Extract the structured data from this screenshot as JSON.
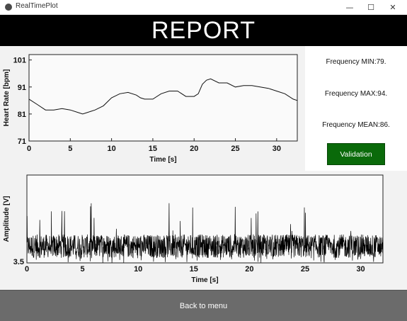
{
  "window": {
    "title": "RealTimePlot",
    "minimize_glyph": "—",
    "maximize_glyph": "☐",
    "close_glyph": "✕"
  },
  "banner": {
    "title": "REPORT"
  },
  "stats": {
    "min": "Frequency MIN:79.",
    "max": "Frequency MAX:94.",
    "mean": "Frequency MEAN:86."
  },
  "buttons": {
    "validation": "Validation",
    "back": "Back to menu"
  },
  "colors": {
    "banner_bg": "#000000",
    "validation_bg": "#0a6a0a",
    "back_bg": "#6b6b6b"
  },
  "chart_data": [
    {
      "type": "line",
      "title": "",
      "xlabel": "Time [s]",
      "ylabel": "Heart Rate [bpm]",
      "xlim": [
        0,
        32.5
      ],
      "ylim": [
        71,
        103
      ],
      "xticks": [
        0,
        5,
        10,
        15,
        20,
        25,
        30
      ],
      "yticks": [
        71,
        81,
        91,
        101
      ],
      "grid": false,
      "series": [
        {
          "x": [
            0,
            1,
            2,
            3,
            4,
            5,
            6,
            6.5,
            7,
            8,
            9,
            10,
            11,
            12,
            13,
            13.5,
            14,
            15,
            16,
            17,
            18,
            19,
            20,
            20.5,
            21,
            21.5,
            22,
            23,
            24,
            25,
            26,
            27,
            28,
            29,
            30,
            31,
            32,
            32.5
          ],
          "y": [
            86.5,
            84.5,
            82.5,
            82.5,
            83,
            82.5,
            81.5,
            81,
            81.5,
            82.5,
            84,
            87,
            88.5,
            89,
            88,
            87,
            86.5,
            86.5,
            88.5,
            89.5,
            89.5,
            87.5,
            87.5,
            88.5,
            92,
            93.5,
            94,
            92.5,
            92.5,
            91,
            91.5,
            91.5,
            91,
            90.5,
            89.5,
            88.5,
            86.5,
            86
          ]
        }
      ]
    },
    {
      "type": "line",
      "title": "",
      "xlabel": "Time [s]",
      "ylabel": "Amplitude [V]",
      "xlim": [
        0,
        32
      ],
      "ylim": [
        3.5,
        14
      ],
      "xticks": [
        0,
        5,
        10,
        15,
        20,
        25,
        30
      ],
      "yticks": [
        3.5
      ],
      "grid": false,
      "series": [
        {
          "x_range": [
            0,
            32
          ],
          "baseline": 5.5,
          "noise_amplitude": 1.4,
          "spike_max": 10.8,
          "spike_min": 3.5
        }
      ]
    }
  ]
}
